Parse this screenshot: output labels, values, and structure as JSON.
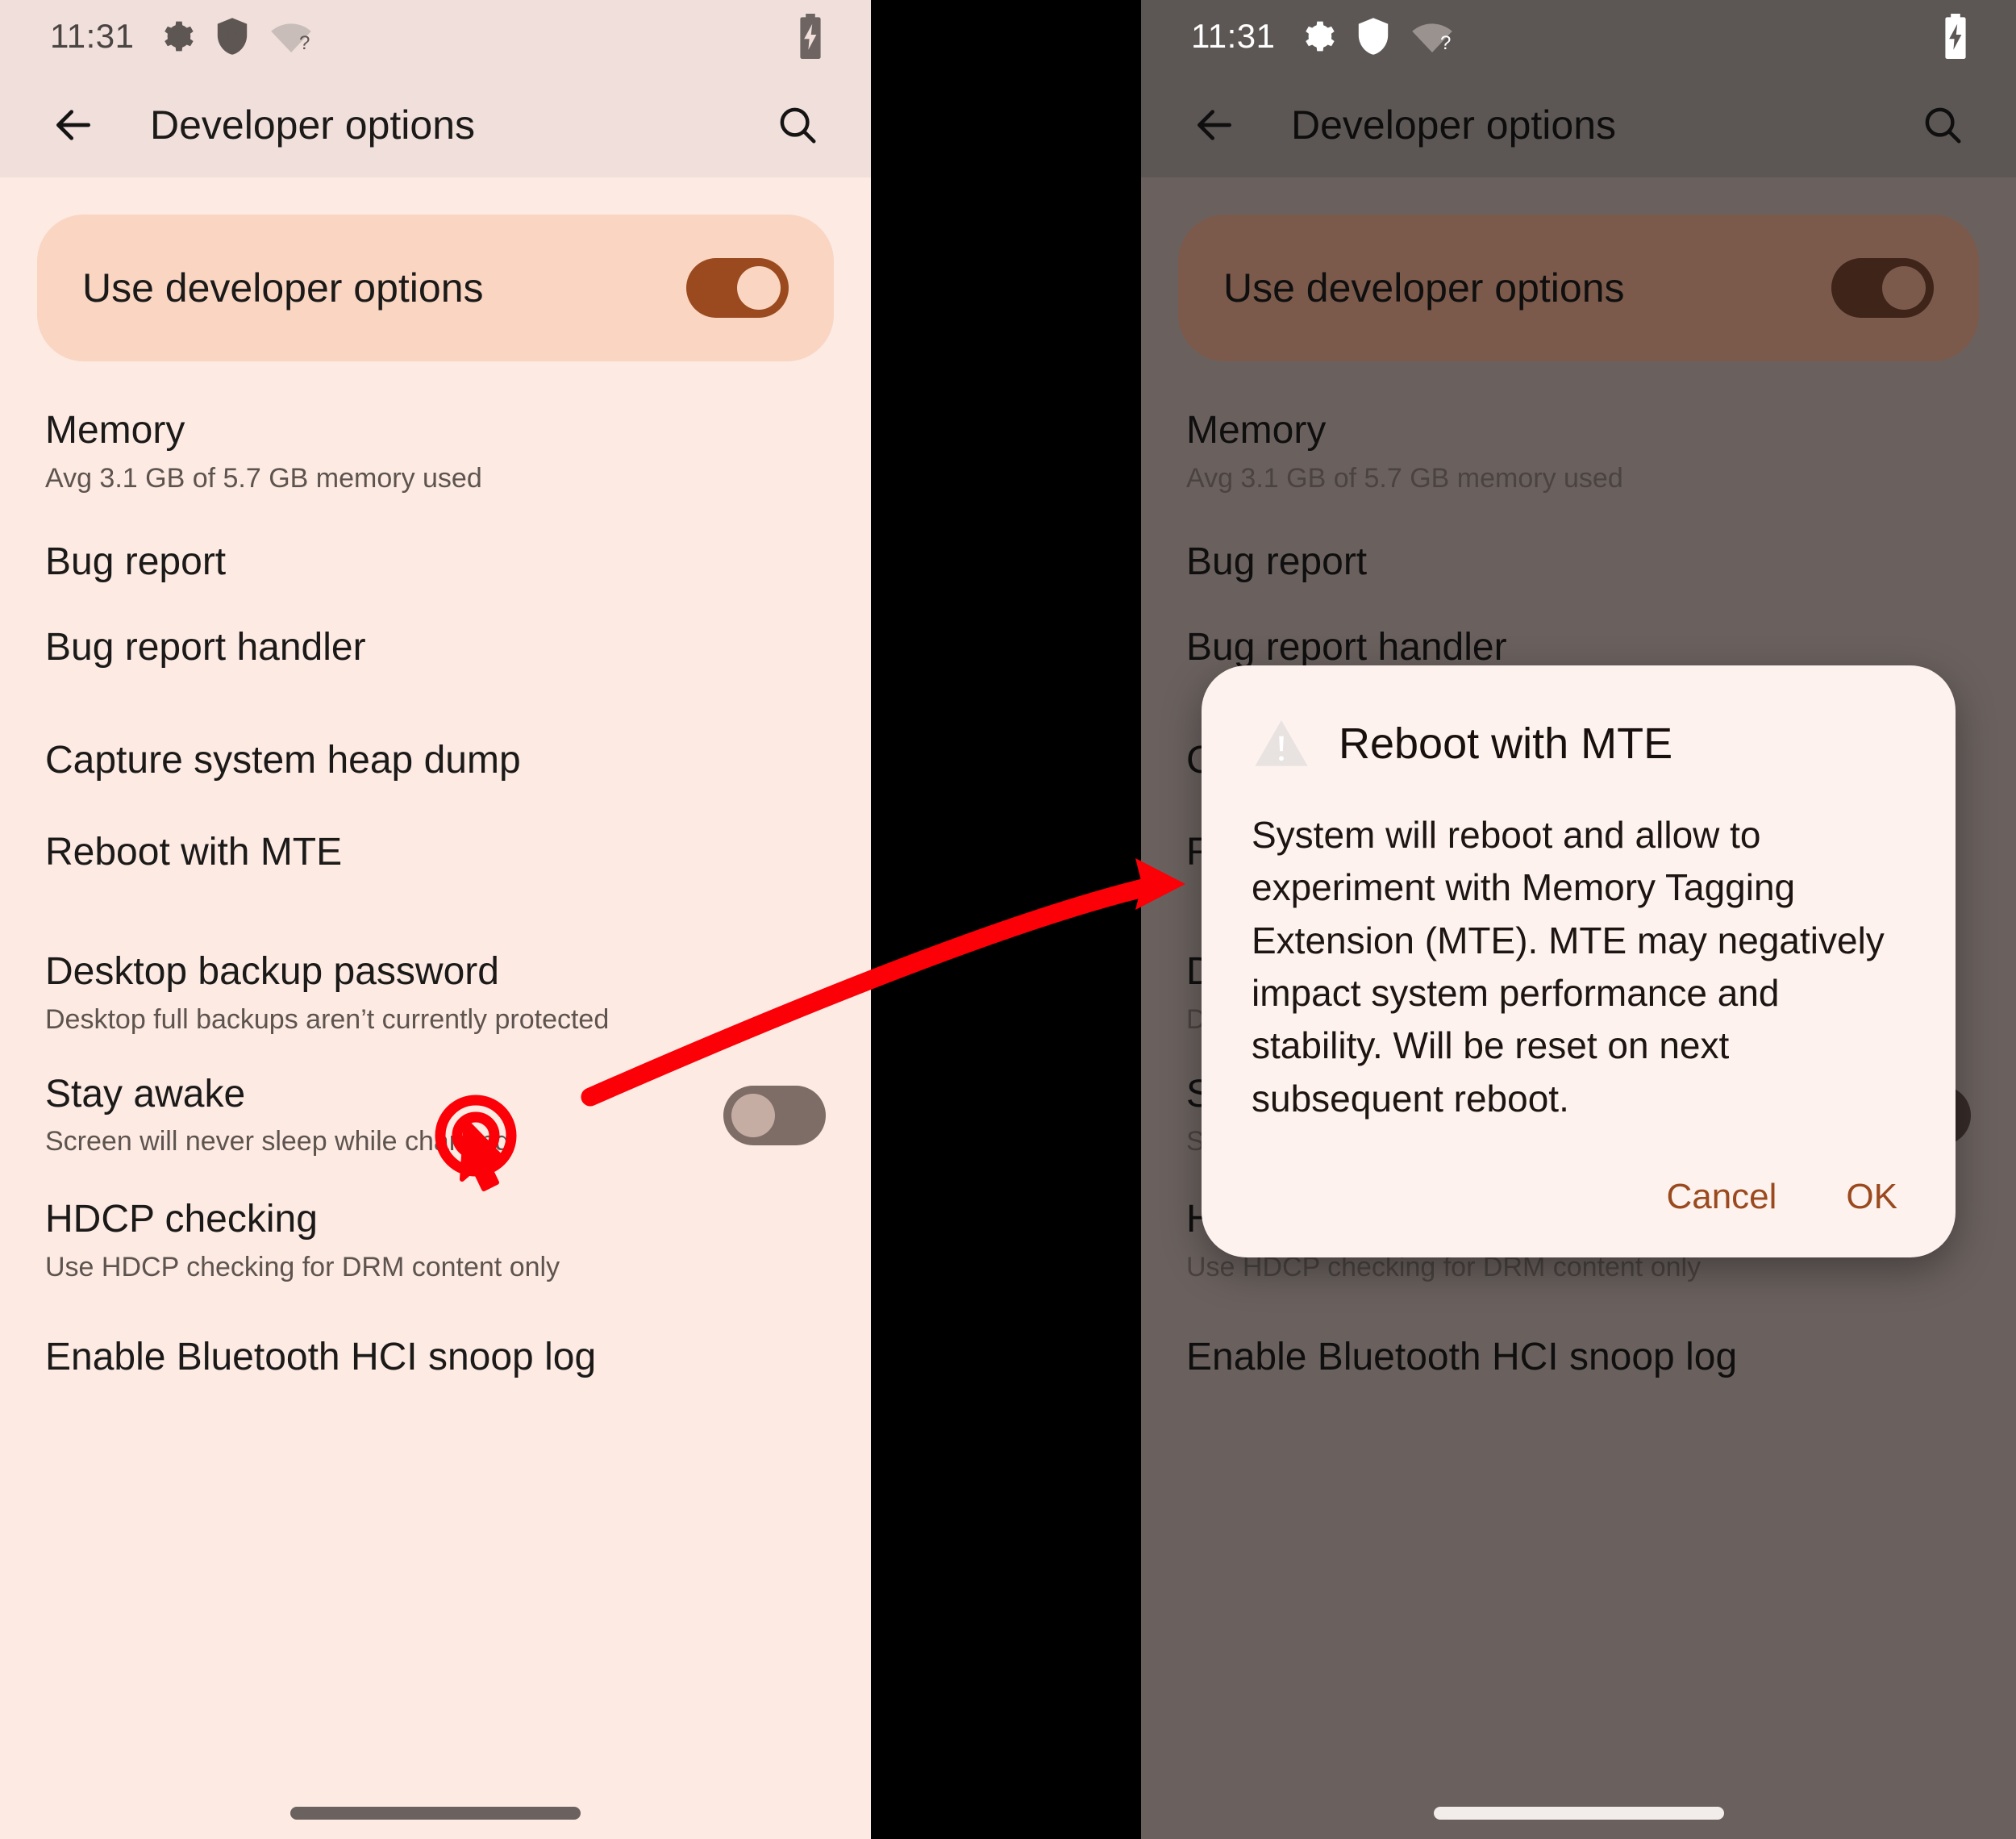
{
  "colors": {
    "accent_brown": "#9A4A1E",
    "panel_bg_light": "#FCEAE3",
    "hero_bg_light": "#F9D5C2",
    "appbar_bg_light": "#F0DFDA",
    "dialog_bg": "#FDF2EE",
    "annotation_red": "#FB0007",
    "dim_panel_bg": "#6A615E"
  },
  "status_bar": {
    "clock": "11:31",
    "icons": [
      "gear-icon",
      "shield-play-icon",
      "wifi-question-icon"
    ],
    "battery": "battery-charging-icon"
  },
  "app_bar": {
    "back_icon": "arrow-left-icon",
    "title": "Developer options",
    "search_icon": "search-icon"
  },
  "hero": {
    "label": "Use developer options",
    "toggle_state": "on"
  },
  "rows": [
    {
      "title": "Memory",
      "subtitle": "Avg 3.1 GB of 5.7 GB memory used",
      "toggle": null
    },
    {
      "title": "Bug report",
      "subtitle": "",
      "toggle": null
    },
    {
      "title": "Bug report handler",
      "subtitle": "",
      "toggle": null
    },
    {
      "title": "Capture system heap dump",
      "subtitle": "",
      "toggle": null
    },
    {
      "title": "Reboot with MTE",
      "subtitle": "",
      "toggle": null
    },
    {
      "title": "Desktop backup password",
      "subtitle": "Desktop full backups aren’t currently protected",
      "toggle": null
    },
    {
      "title": "Stay awake",
      "subtitle": "Screen will never sleep while charging",
      "toggle": "off"
    },
    {
      "title": "HDCP checking",
      "subtitle": "Use HDCP checking for DRM content only",
      "toggle": null
    },
    {
      "title": "Enable Bluetooth HCI snoop log",
      "subtitle": "",
      "toggle": null
    }
  ],
  "dialog": {
    "icon": "warning-triangle-icon",
    "title": "Reboot with MTE",
    "body": "System will reboot and allow to experiment with Memory Tagging Extension (MTE). MTE may negatively impact system performance and stability. Will be reset on next subsequent reboot.",
    "cancel_label": "Cancel",
    "ok_label": "OK"
  },
  "annotation": {
    "click_target": "Reboot with MTE",
    "arrow": "curved-arrow-left-to-right"
  }
}
